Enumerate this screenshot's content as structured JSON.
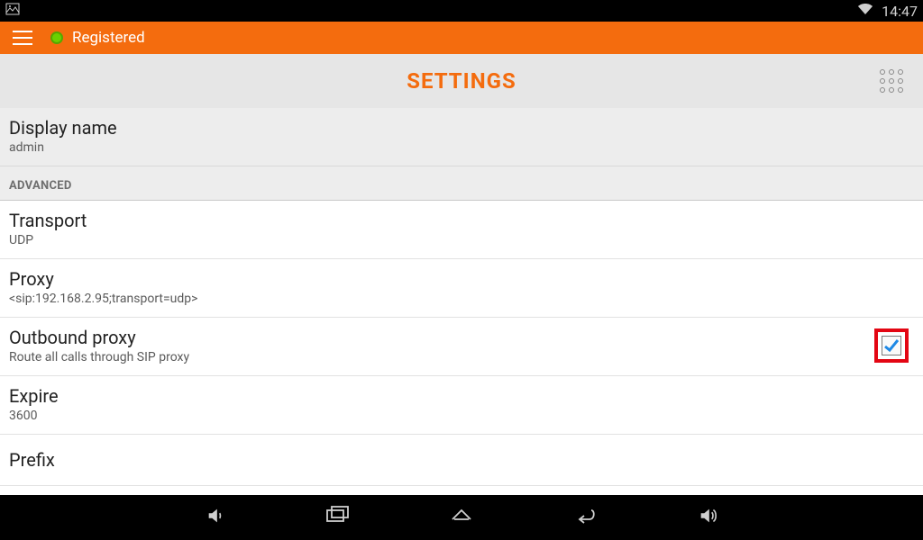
{
  "status": {
    "time": "14:47"
  },
  "actionbar": {
    "status_text": "Registered"
  },
  "header": {
    "title": "SETTINGS"
  },
  "rows": {
    "display_name": {
      "title": "Display name",
      "value": "admin"
    },
    "section": "ADVANCED",
    "transport": {
      "title": "Transport",
      "value": "UDP"
    },
    "proxy": {
      "title": "Proxy",
      "value": "<sip:192.168.2.95;transport=udp>"
    },
    "outbound": {
      "title": "Outbound proxy",
      "desc": "Route all calls through SIP proxy",
      "checked": true
    },
    "expire": {
      "title": "Expire",
      "value": "3600"
    },
    "prefix": {
      "title": "Prefix"
    }
  }
}
